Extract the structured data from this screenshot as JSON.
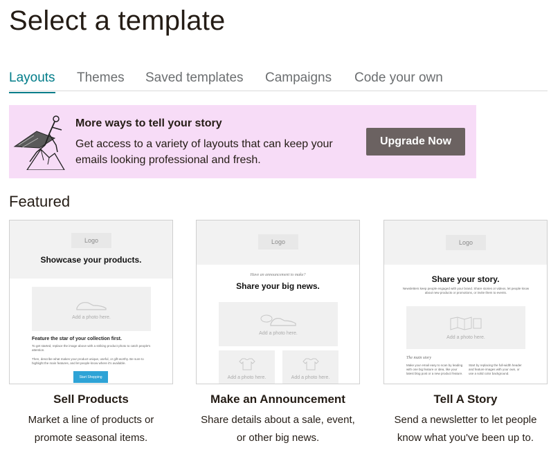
{
  "page": {
    "title": "Select a template"
  },
  "tabs": [
    {
      "label": "Layouts",
      "active": true
    },
    {
      "label": "Themes",
      "active": false
    },
    {
      "label": "Saved templates",
      "active": false
    },
    {
      "label": "Campaigns",
      "active": false
    },
    {
      "label": "Code your own",
      "active": false
    }
  ],
  "banner": {
    "heading": "More ways to tell your story",
    "body": "Get access to a variety of layouts that can keep your emails looking professional and fresh.",
    "button": "Upgrade Now",
    "illustration_icon": "hiker-on-mountain-illustration"
  },
  "featured": {
    "heading": "Featured",
    "cards": [
      {
        "title": "Sell Products",
        "description": "Market a line of products or promote seasonal items.",
        "preview": {
          "logo": "Logo",
          "headline": "Showcase your products.",
          "photo_caption": "Add a photo here.",
          "subheading": "Feature the star of your collection first.",
          "body_1": "To get started, replace the image above with a striking product photo to catch people's attention.",
          "body_2": "Then, describe what makes your product unique, useful, or gift-worthy. Be sure to highlight the main features, and let people know where it's available.",
          "cta": "Start Shopping"
        }
      },
      {
        "title": "Make an Announcement",
        "description": "Share details about a sale, event, or other big news.",
        "preview": {
          "logo": "Logo",
          "kicker": "Have an announcement to make?",
          "headline": "Share your big news.",
          "photo_caption": "Add a photo here.",
          "photo_caption_2": "Add a photo here.",
          "photo_caption_3": "Add a photo here."
        }
      },
      {
        "title": "Tell A Story",
        "description": "Send a newsletter to let people know what you've been up to.",
        "preview": {
          "logo": "Logo",
          "headline": "Share your story.",
          "intro": "Newsletters keep people engaged with your brand. Share stories or videos, let people know about new products or promotions, or invite them to events.",
          "photo_caption": "Add a photo here.",
          "section_label": "The main story",
          "col_1": "Make your email easy to scan by leading with one big feature or idea, like your latest blog post or a new product feature.",
          "col_2": "Start by replacing the full-width header and feature images with your own, or use a solid color background."
        }
      }
    ]
  },
  "colors": {
    "accent": "#007c89",
    "banner_bg": "#f7dcf7",
    "button_bg": "#6b6261",
    "cta_blue": "#2ea3d6"
  }
}
